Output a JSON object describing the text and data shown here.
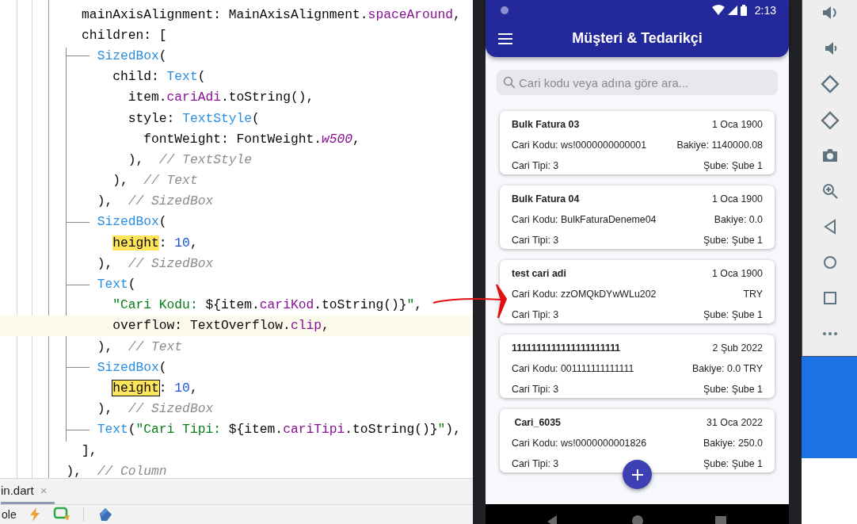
{
  "editor": {
    "lines": [
      {
        "branch": false,
        "current": false,
        "tokens": [
          {
            "text": "    mainAxisAlignment: MainAxisAlignment.",
            "kind": "plain"
          },
          {
            "text": "spaceAround",
            "kind": "prop"
          },
          {
            "text": ",",
            "kind": "plain"
          }
        ]
      },
      {
        "branch": false,
        "current": false,
        "tokens": [
          {
            "text": "    children: [",
            "kind": "plain"
          }
        ]
      },
      {
        "branch": true,
        "current": false,
        "tokens": [
          {
            "text": "      SizedBox",
            "kind": "class"
          },
          {
            "text": "(",
            "kind": "plain"
          }
        ]
      },
      {
        "branch": false,
        "current": false,
        "tokens": [
          {
            "text": "        child: ",
            "kind": "plain"
          },
          {
            "text": "Text",
            "kind": "class"
          },
          {
            "text": "(",
            "kind": "plain"
          }
        ]
      },
      {
        "branch": false,
        "current": false,
        "tokens": [
          {
            "text": "          item.",
            "kind": "plain"
          },
          {
            "text": "cariAdi",
            "kind": "prop"
          },
          {
            "text": ".toString(),",
            "kind": "plain"
          }
        ]
      },
      {
        "branch": false,
        "current": false,
        "tokens": [
          {
            "text": "          style: ",
            "kind": "plain"
          },
          {
            "text": "TextStyle",
            "kind": "class"
          },
          {
            "text": "(",
            "kind": "plain"
          }
        ]
      },
      {
        "branch": false,
        "current": false,
        "tokens": [
          {
            "text": "            fontWeight: FontWeight.",
            "kind": "plain"
          },
          {
            "text": "w500",
            "kind": "const"
          },
          {
            "text": ",",
            "kind": "plain"
          }
        ]
      },
      {
        "branch": false,
        "current": false,
        "tokens": [
          {
            "text": "          ),  ",
            "kind": "plain"
          },
          {
            "text": "// TextStyle",
            "kind": "comment"
          }
        ]
      },
      {
        "branch": false,
        "current": false,
        "tokens": [
          {
            "text": "        ),  ",
            "kind": "plain"
          },
          {
            "text": "// Text",
            "kind": "comment"
          }
        ]
      },
      {
        "branch": false,
        "current": false,
        "tokens": [
          {
            "text": "      ),  ",
            "kind": "plain"
          },
          {
            "text": "// SizedBox",
            "kind": "comment"
          }
        ]
      },
      {
        "branch": true,
        "current": false,
        "tokens": [
          {
            "text": "      SizedBox",
            "kind": "class"
          },
          {
            "text": "(",
            "kind": "plain"
          }
        ]
      },
      {
        "branch": false,
        "current": false,
        "tokens": [
          {
            "text": "        height",
            "kind": "match"
          },
          {
            "text": ": ",
            "kind": "plain"
          },
          {
            "text": "10",
            "kind": "num"
          },
          {
            "text": ",",
            "kind": "plain"
          }
        ]
      },
      {
        "branch": false,
        "current": false,
        "tokens": [
          {
            "text": "      ),  ",
            "kind": "plain"
          },
          {
            "text": "// SizedBox",
            "kind": "comment"
          }
        ]
      },
      {
        "branch": true,
        "current": false,
        "tokens": [
          {
            "text": "      Text",
            "kind": "class"
          },
          {
            "text": "(",
            "kind": "plain"
          }
        ]
      },
      {
        "branch": false,
        "current": false,
        "tokens": [
          {
            "text": "        \"Cari Kodu: ",
            "kind": "str"
          },
          {
            "text": "${item.",
            "kind": "plain"
          },
          {
            "text": "cariKod",
            "kind": "prop"
          },
          {
            "text": ".toString()}",
            "kind": "plain"
          },
          {
            "text": "\"",
            "kind": "str"
          },
          {
            "text": ",",
            "kind": "plain"
          }
        ]
      },
      {
        "branch": false,
        "current": true,
        "tokens": [
          {
            "text": "        overflow: TextOverflow.",
            "kind": "plain"
          },
          {
            "text": "clip",
            "kind": "prop"
          },
          {
            "text": ",",
            "kind": "plain"
          }
        ]
      },
      {
        "branch": false,
        "current": false,
        "tokens": [
          {
            "text": "      ),  ",
            "kind": "plain"
          },
          {
            "text": "// Text",
            "kind": "comment"
          }
        ]
      },
      {
        "branch": true,
        "current": false,
        "tokens": [
          {
            "text": "      SizedBox",
            "kind": "class"
          },
          {
            "text": "(",
            "kind": "plain"
          }
        ]
      },
      {
        "branch": false,
        "current": false,
        "tokens": [
          {
            "text": "        height",
            "kind": "match_current"
          },
          {
            "text": ": ",
            "kind": "plain"
          },
          {
            "text": "10",
            "kind": "num"
          },
          {
            "text": ",",
            "kind": "plain"
          }
        ]
      },
      {
        "branch": false,
        "current": false,
        "tokens": [
          {
            "text": "      ),  ",
            "kind": "plain"
          },
          {
            "text": "// SizedBox",
            "kind": "comment"
          }
        ]
      },
      {
        "branch": true,
        "current": false,
        "tokens": [
          {
            "text": "      Text",
            "kind": "class"
          },
          {
            "text": "(",
            "kind": "plain"
          },
          {
            "text": "\"Cari Tipi: ",
            "kind": "str"
          },
          {
            "text": "${item.",
            "kind": "plain"
          },
          {
            "text": "cariTipi",
            "kind": "prop"
          },
          {
            "text": ".toString()}",
            "kind": "plain"
          },
          {
            "text": "\"",
            "kind": "str"
          },
          {
            "text": "),",
            "kind": "plain"
          }
        ]
      },
      {
        "branch": false,
        "current": false,
        "tokens": [
          {
            "text": "    ],",
            "kind": "plain"
          }
        ]
      },
      {
        "branch": false,
        "current": false,
        "tokens": [
          {
            "text": "  ),  ",
            "kind": "plain"
          },
          {
            "text": "// Column",
            "kind": "comment"
          }
        ]
      }
    ],
    "tab": {
      "label": "in.dart",
      "close": "×"
    },
    "toolbar": {
      "label": "ole"
    }
  },
  "phone": {
    "status": {
      "time": "2:13"
    },
    "app_bar": {
      "title": "Müşteri & Tedarikçi"
    },
    "search": {
      "placeholder": "Cari kodu veya adına göre ara..."
    },
    "cards": [
      {
        "name": "Bulk Fatura 03",
        "date": "1 Oca 1900",
        "code": "Cari Kodu: ws!0000000000001",
        "balance": "Bakiye: 1140000.08",
        "type": "Cari Tipi: 3",
        "branch": "Şube: Şube 1"
      },
      {
        "name": "Bulk Fatura 04",
        "date": "1 Oca 1900",
        "code": "Cari Kodu: BulkFaturaDeneme04",
        "balance": "Bakiye: 0.0",
        "type": "Cari Tipi: 3",
        "branch": "Şube: Şube 1"
      },
      {
        "name": "test cari adi",
        "date": "1 Oca 1900",
        "code": "Cari Kodu: zzOMQkDYwWLu202",
        "balance": "TRY",
        "type": "Cari Tipi: 3",
        "branch": "Şube: Şube 1"
      },
      {
        "name": "1111111111111111111111",
        "date": "2 Şub 2022",
        "code": "Cari Kodu: 001111111111111",
        "balance": "Bakiye: 0.0 TRY",
        "type": "Cari Tipi: 3",
        "branch": "Şube: Şube 1"
      },
      {
        "name": " Cari_6035",
        "date": "31 Oca 2022",
        "code": "Cari Kodu: ws!0000000001826",
        "balance": "Bakiye: 250.0",
        "type": "Cari Tipi: 3",
        "branch": "Şube: Şube 1"
      }
    ]
  }
}
